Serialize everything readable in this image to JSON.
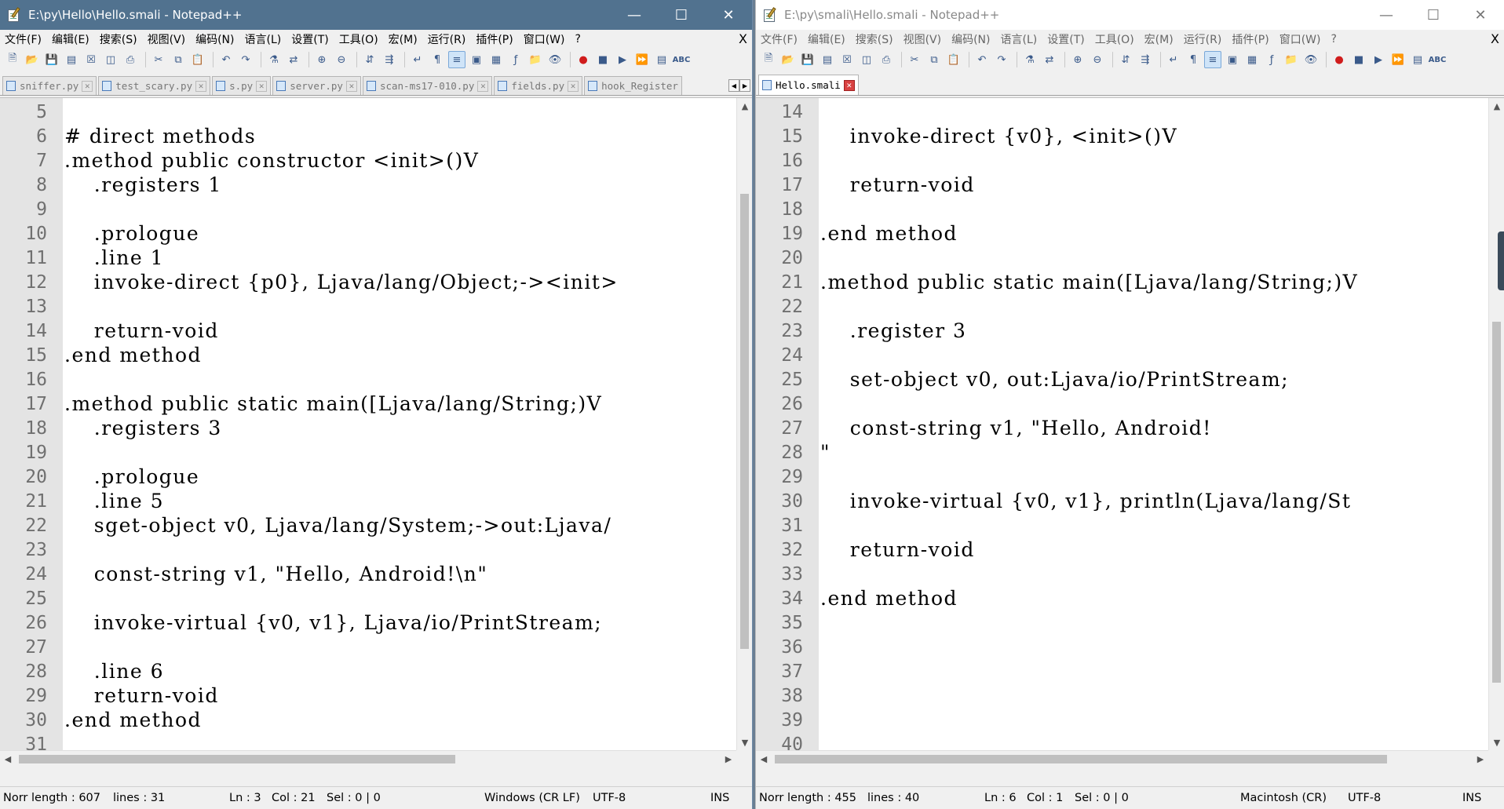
{
  "left": {
    "title": "E:\\py\\Hello\\Hello.smali - Notepad++",
    "menu": [
      "文件(F)",
      "编辑(E)",
      "搜索(S)",
      "视图(V)",
      "编码(N)",
      "语言(L)",
      "设置(T)",
      "工具(O)",
      "宏(M)",
      "运行(R)",
      "插件(P)",
      "窗口(W)",
      "?"
    ],
    "menu_close": "X",
    "tabs": [
      "sniffer.py",
      "test_scary.py",
      "s.py",
      "server.py",
      "scan-ms17-010.py",
      "fields.py",
      "hook_Register"
    ],
    "lines": [
      {
        "n": "5",
        "t": ""
      },
      {
        "n": "6",
        "t": "# direct methods"
      },
      {
        "n": "7",
        "t": ".method public constructor <init>()V"
      },
      {
        "n": "8",
        "t": "    .registers 1"
      },
      {
        "n": "9",
        "t": ""
      },
      {
        "n": "10",
        "t": "    .prologue"
      },
      {
        "n": "11",
        "t": "    .line 1"
      },
      {
        "n": "12",
        "t": "    invoke-direct {p0}, Ljava/lang/Object;-><init>"
      },
      {
        "n": "13",
        "t": ""
      },
      {
        "n": "14",
        "t": "    return-void"
      },
      {
        "n": "15",
        "t": ".end method"
      },
      {
        "n": "16",
        "t": ""
      },
      {
        "n": "17",
        "t": ".method public static main([Ljava/lang/String;)V"
      },
      {
        "n": "18",
        "t": "    .registers 3"
      },
      {
        "n": "19",
        "t": ""
      },
      {
        "n": "20",
        "t": "    .prologue"
      },
      {
        "n": "21",
        "t": "    .line 5"
      },
      {
        "n": "22",
        "t": "    sget-object v0, Ljava/lang/System;->out:Ljava/"
      },
      {
        "n": "23",
        "t": ""
      },
      {
        "n": "24",
        "t": "    const-string v1, \"Hello, Android!\\n\""
      },
      {
        "n": "25",
        "t": ""
      },
      {
        "n": "26",
        "t": "    invoke-virtual {v0, v1}, Ljava/io/PrintStream;"
      },
      {
        "n": "27",
        "t": ""
      },
      {
        "n": "28",
        "t": "    .line 6"
      },
      {
        "n": "29",
        "t": "    return-void"
      },
      {
        "n": "30",
        "t": ".end method"
      },
      {
        "n": "31",
        "t": ""
      }
    ],
    "status": {
      "length": "Norr length : 607",
      "lines": "lines : 31",
      "ln": "Ln : 3",
      "col": "Col : 21",
      "sel": "Sel : 0 | 0",
      "eol": "Windows (CR LF)",
      "enc": "UTF-8",
      "ins": "INS"
    }
  },
  "right": {
    "title": "E:\\py\\smali\\Hello.smali - Notepad++",
    "menu": [
      "文件(F)",
      "编辑(E)",
      "搜索(S)",
      "视图(V)",
      "编码(N)",
      "语言(L)",
      "设置(T)",
      "工具(O)",
      "宏(M)",
      "运行(R)",
      "插件(P)",
      "窗口(W)",
      "?"
    ],
    "menu_close": "X",
    "tabs": [
      "Hello.smali"
    ],
    "lines": [
      {
        "n": "14",
        "t": ""
      },
      {
        "n": "15",
        "t": "    invoke-direct {v0}, <init>()V"
      },
      {
        "n": "16",
        "t": ""
      },
      {
        "n": "17",
        "t": "    return-void"
      },
      {
        "n": "18",
        "t": ""
      },
      {
        "n": "19",
        "t": ".end method"
      },
      {
        "n": "20",
        "t": ""
      },
      {
        "n": "21",
        "t": ".method public static main([Ljava/lang/String;)V"
      },
      {
        "n": "22",
        "t": ""
      },
      {
        "n": "23",
        "t": "    .register 3"
      },
      {
        "n": "24",
        "t": ""
      },
      {
        "n": "25",
        "t": "    set-object v0, out:Ljava/io/PrintStream;"
      },
      {
        "n": "26",
        "t": ""
      },
      {
        "n": "27",
        "t": "    const-string v1, \"Hello, Android!"
      },
      {
        "n": "28",
        "t": "\""
      },
      {
        "n": "29",
        "t": ""
      },
      {
        "n": "30",
        "t": "    invoke-virtual {v0, v1}, println(Ljava/lang/St"
      },
      {
        "n": "31",
        "t": ""
      },
      {
        "n": "32",
        "t": "    return-void"
      },
      {
        "n": "33",
        "t": ""
      },
      {
        "n": "34",
        "t": ".end method"
      },
      {
        "n": "35",
        "t": ""
      },
      {
        "n": "36",
        "t": ""
      },
      {
        "n": "37",
        "t": ""
      },
      {
        "n": "38",
        "t": ""
      },
      {
        "n": "39",
        "t": ""
      },
      {
        "n": "40",
        "t": ""
      }
    ],
    "status": {
      "length": "Norr length : 455",
      "lines": "lines : 40",
      "ln": "Ln : 6",
      "col": "Col : 1",
      "sel": "Sel : 0 | 0",
      "eol": "Macintosh (CR)",
      "enc": "UTF-8",
      "ins": "INS"
    }
  },
  "toolbar_icons": [
    "new-icon",
    "open-icon",
    "save-icon",
    "save-all-icon",
    "close-icon",
    "close-all-icon",
    "print-icon",
    "cut-icon",
    "copy-icon",
    "paste-icon",
    "undo-icon",
    "redo-icon",
    "find-icon",
    "replace-icon",
    "zoom-in-icon",
    "zoom-out-icon",
    "sync-v-icon",
    "sync-h-icon",
    "word-wrap-icon",
    "show-all-chars-icon",
    "indent-guide-icon",
    "lang-icon",
    "doc-map-icon",
    "function-list-icon",
    "folder-workspace-icon",
    "monitor-icon",
    "record-macro-icon",
    "stop-macro-icon",
    "play-macro-icon",
    "run-macro-multiple-icon",
    "save-macro-icon",
    "spellcheck-icon"
  ]
}
